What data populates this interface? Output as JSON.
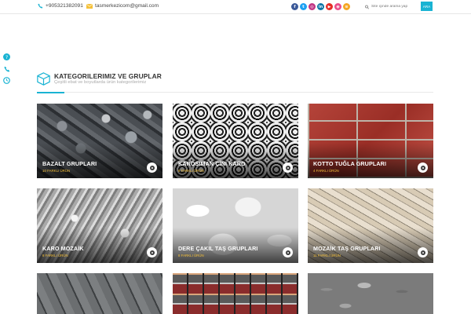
{
  "topbar": {
    "phone": "+905321382091",
    "email": "tasmerkezicom@gmail.com",
    "search_placeholder": "Site içinde arama yap",
    "search_button": "ARA",
    "socials": [
      {
        "name": "facebook-icon",
        "glyph": "f",
        "color": "#3b5998"
      },
      {
        "name": "twitter-icon",
        "glyph": "t",
        "color": "#1da1f2"
      },
      {
        "name": "instagram-icon",
        "glyph": "◎",
        "color": "#c13584"
      },
      {
        "name": "linkedin-icon",
        "glyph": "in",
        "color": "#0e76a8"
      },
      {
        "name": "youtube-icon",
        "glyph": "▶",
        "color": "#e52d27"
      },
      {
        "name": "dribbble-icon",
        "glyph": "◉",
        "color": "#ea4c89"
      },
      {
        "name": "rss-icon",
        "glyph": "≋",
        "color": "#f5a623"
      }
    ]
  },
  "section": {
    "title": "KATEGORILERIMIZ VE GRUPLAR",
    "subtitle": "Çeşitli ebat ve boyutlarda ürün kategorilerimiz"
  },
  "accent_color": "#19b3d3",
  "categories": [
    {
      "title": "BAZALT GRUPLARI",
      "count": "10 FARKLI ÜRÜN"
    },
    {
      "title": "KAROSIMAN ÇİNİ KARO",
      "count": "6 FARKLI ÜRÜN"
    },
    {
      "title": "KOTTO TUĞLA GRUPLARI",
      "count": "4 FARKLI ÜRÜN"
    },
    {
      "title": "KARO MOZAİK",
      "count": "8 FARKLI ÜRÜN"
    },
    {
      "title": "DERE ÇAKIL TAŞ GRUPLARI",
      "count": "8 FARKLI ÜRÜN"
    },
    {
      "title": "MOZAİK TAŞ GRUPLARI",
      "count": "11 FARKLI ÜRÜN"
    }
  ]
}
